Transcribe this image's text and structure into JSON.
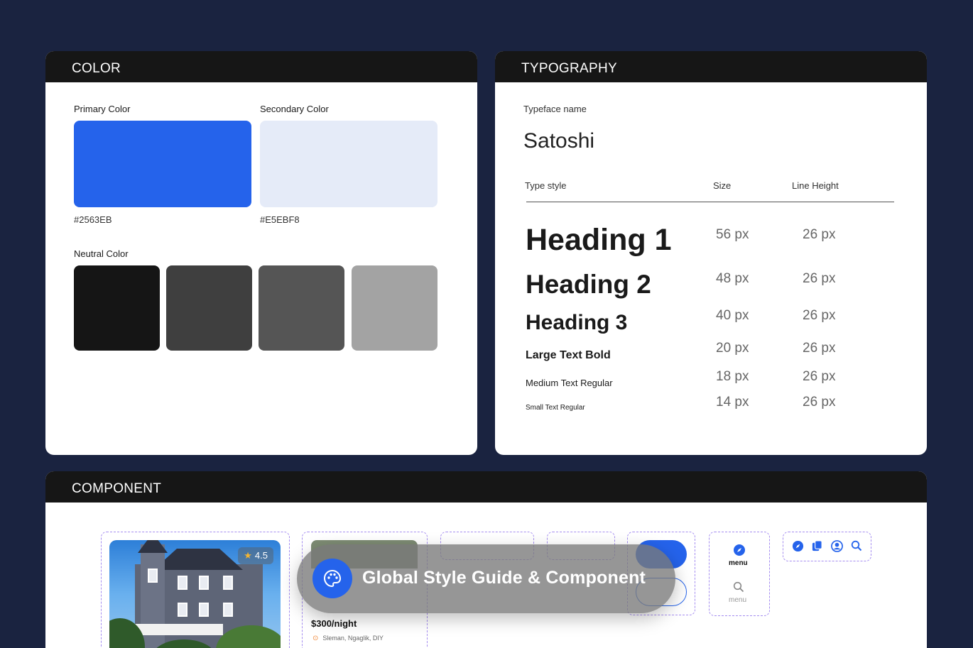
{
  "color": {
    "title": "COLOR",
    "primary_label": "Primary Color",
    "primary_hex": "#2563EB",
    "secondary_label": "Secondary Color",
    "secondary_hex": "#E5EBF8",
    "neutral_label": "Neutral Color",
    "neutrals": [
      "#151515",
      "#3f3f3f",
      "#555555",
      "#a3a3a3"
    ]
  },
  "typography": {
    "title": "TYPOGRAPHY",
    "typeface_label": "Typeface name",
    "typeface": "Satoshi",
    "headers": {
      "style": "Type style",
      "size": "Size",
      "line_height": "Line Height"
    },
    "rows": [
      {
        "name": "Heading 1",
        "size": "56 px",
        "line": "26 px"
      },
      {
        "name": "Heading 2",
        "size": "48 px",
        "line": "26 px"
      },
      {
        "name": "Heading 3",
        "size": "40 px",
        "line": "26 px"
      },
      {
        "name": "Large Text Bold",
        "size": "20 px",
        "line": "26 px"
      },
      {
        "name": "Medium Text Regular",
        "size": "18 px",
        "line": "26 px"
      },
      {
        "name": "Small Text Regular",
        "size": "14 px",
        "line": "26 px"
      }
    ]
  },
  "component": {
    "title": "COMPONENT",
    "card": {
      "rating": "4.5",
      "price": "$300/night",
      "location": "Sleman, Ngaglik, DIY"
    },
    "nav": {
      "active_label": "menu",
      "inactive_label": "menu"
    },
    "icons": [
      "compass-icon",
      "copy-icon",
      "user-icon",
      "search-icon"
    ],
    "overlay_title": "Global Style Guide & Component"
  }
}
